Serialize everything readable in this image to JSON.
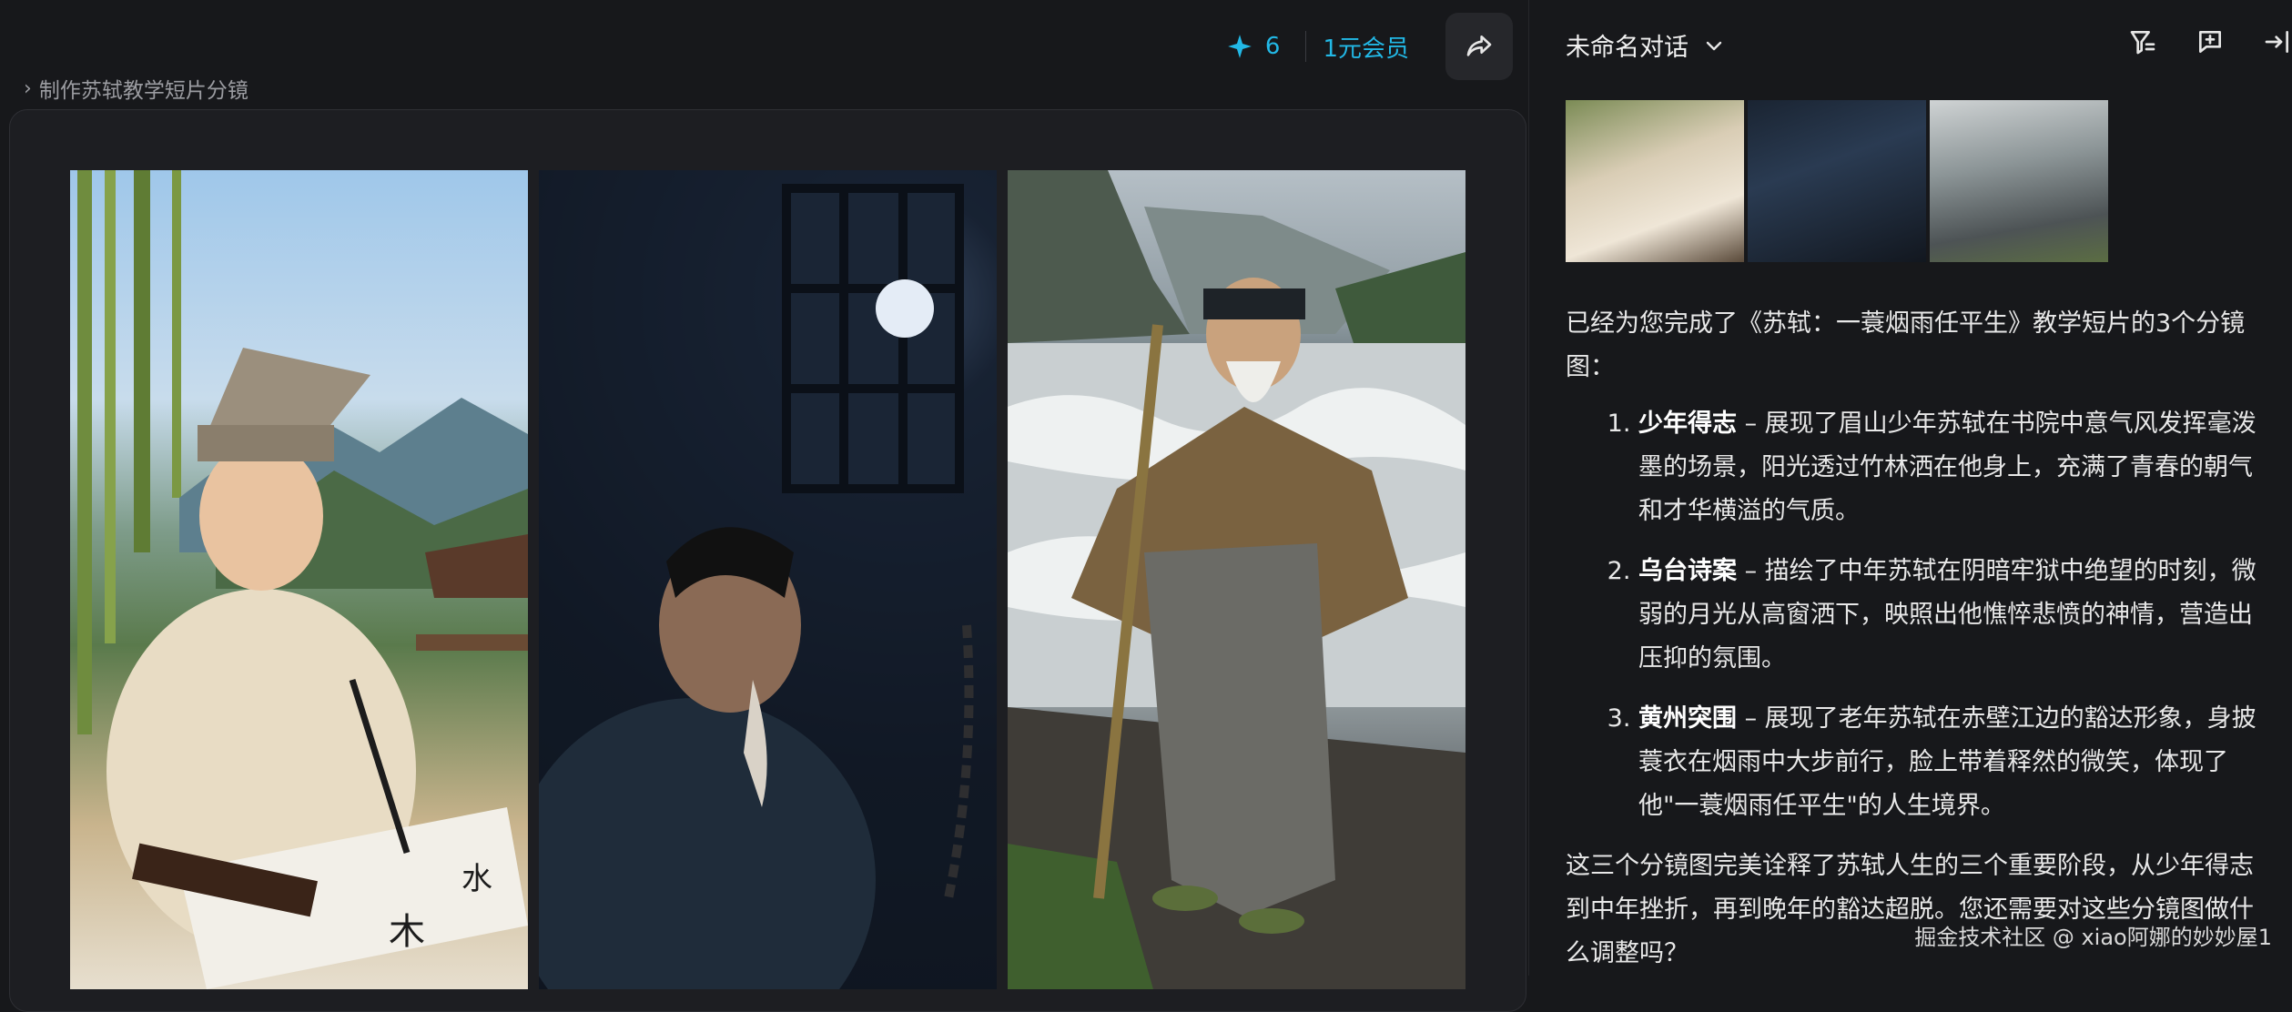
{
  "toolbar": {
    "credits_count": "6",
    "member_label": "1元会员"
  },
  "breadcrumb": {
    "chevron": "›",
    "text": "制作苏轼教学短片分镜"
  },
  "conversation": {
    "title": "未命名对话"
  },
  "message": {
    "intro": "已经为您完成了《苏轼：一蓑烟雨任平生》教学短片的3个分镜图：",
    "items": [
      {
        "title": "少年得志",
        "text": " – 展现了眉山少年苏轼在书院中意气风发挥毫泼墨的场景，阳光透过竹林洒在他身上，充满了青春的朝气和才华横溢的气质。"
      },
      {
        "title": "乌台诗案",
        "text": " – 描绘了中年苏轼在阴暗牢狱中绝望的时刻，微弱的月光从高窗洒下，映照出他憔悴悲愤的神情，营造出压抑的氛围。"
      },
      {
        "title": "黄州突围",
        "text": " – 展现了老年苏轼在赤壁江边的豁达形象，身披蓑衣在烟雨中大步前行，脸上带着释然的微笑，体现了他\"一蓑烟雨任平生\"的人生境界。"
      }
    ],
    "closing": "这三个分镜图完美诠释了苏轼人生的三个重要阶段，从少年得志到中年挫折，再到晚年的豁达超脱。您还需要对这些分镜图做什么调整吗？"
  },
  "watermark": "掘金技术社区 @ xiao阿娜的妙妙屋1",
  "colors": {
    "accent": "#22b8e6",
    "background": "#17181b",
    "card": "#1d1e22"
  },
  "icons": {
    "credits": "sparkle-icon",
    "share": "share-icon",
    "title_dropdown": "chevron-down-icon",
    "header": [
      "filter-icon",
      "new-chat-icon",
      "collapse-panel-icon"
    ]
  }
}
